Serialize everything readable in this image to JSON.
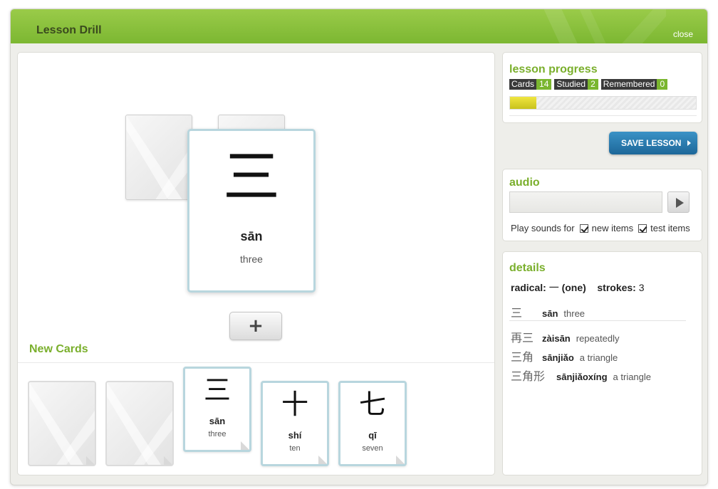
{
  "window": {
    "title": "Lesson Drill",
    "close_label": "close"
  },
  "current_card": {
    "character": "三",
    "pinyin": "sān",
    "meaning": "three"
  },
  "add_button": {
    "label": "+"
  },
  "new_cards": {
    "title": "New Cards",
    "cards": [
      {
        "character": "",
        "pinyin": "",
        "meaning": ""
      },
      {
        "character": "",
        "pinyin": "",
        "meaning": ""
      },
      {
        "character": "三",
        "pinyin": "sān",
        "meaning": "three"
      },
      {
        "character": "十",
        "pinyin": "shí",
        "meaning": "ten"
      },
      {
        "character": "七",
        "pinyin": "qī",
        "meaning": "seven"
      }
    ]
  },
  "lesson_progress": {
    "title": "lesson progress",
    "cards_label": "Cards",
    "cards_count": "14",
    "studied_label": "Studied",
    "studied_count": "2",
    "remembered_label": "Remembered",
    "remembered_count": "0",
    "progress_fraction": 0.14
  },
  "save_lesson": {
    "label": "SAVE LESSON"
  },
  "audio": {
    "title": "audio",
    "play_sounds_label": "Play sounds for",
    "new_items_label": "new items",
    "test_items_label": "test items"
  },
  "details": {
    "title": "details",
    "radical_label": "radical:",
    "radical_value": "一",
    "radical_meaning": "(one)",
    "strokes_label": "strokes:",
    "strokes_value": "3",
    "main": {
      "character": "三",
      "pinyin": "sān",
      "meaning": "three"
    },
    "words": [
      {
        "character": "再三",
        "pinyin": "zàisān",
        "meaning": "repeatedly"
      },
      {
        "character": "三角",
        "pinyin": "sānjiǎo",
        "meaning": "a triangle"
      },
      {
        "character": "三角形",
        "pinyin": "sānjiǎoxíng",
        "meaning": "a triangle"
      }
    ]
  },
  "colors": {
    "accent_green": "#7aaf2c",
    "header_green": "#8cc13f",
    "button_blue": "#2a7db3",
    "card_border": "#b8d6de"
  },
  "icons": [
    "plus-icon",
    "play-icon",
    "chevron-right-icon",
    "checkbox-checked-icon"
  ]
}
